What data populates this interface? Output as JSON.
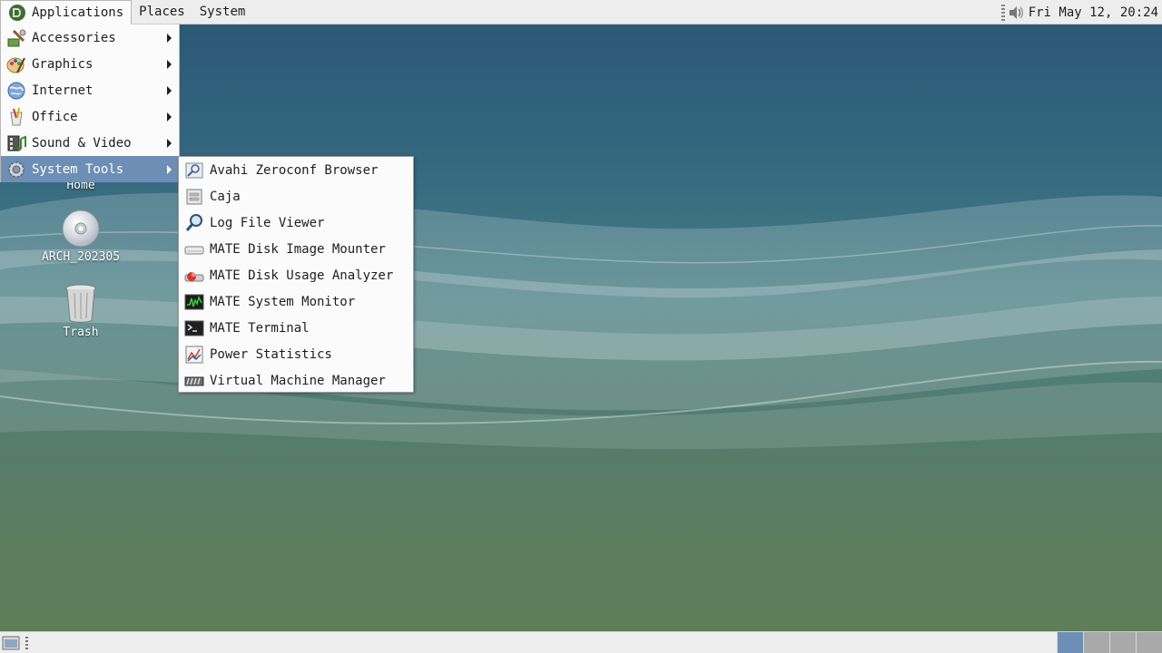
{
  "top_panel": {
    "menus": [
      {
        "label": "Applications",
        "active": true
      },
      {
        "label": "Places"
      },
      {
        "label": "System"
      }
    ],
    "clock": "Fri May 12, 20:24",
    "tray_icons": [
      "volume-icon"
    ]
  },
  "desktop": {
    "icons": [
      {
        "label": "Home",
        "icon": "home-folder-icon"
      },
      {
        "label": "ARCH_202305",
        "icon": "optical-disc-icon"
      },
      {
        "label": "Trash",
        "icon": "trash-icon"
      }
    ]
  },
  "app_menu": {
    "items": [
      {
        "label": "Accessories",
        "icon": "accessories-icon"
      },
      {
        "label": "Graphics",
        "icon": "graphics-icon"
      },
      {
        "label": "Internet",
        "icon": "internet-globe-icon"
      },
      {
        "label": "Office",
        "icon": "office-icon"
      },
      {
        "label": "Sound & Video",
        "icon": "sound-video-icon"
      },
      {
        "label": "System Tools",
        "icon": "system-tools-gear-icon",
        "highlighted": true
      }
    ]
  },
  "system_tools_submenu": {
    "items": [
      {
        "label": "Avahi Zeroconf Browser",
        "icon": "avahi-browser-icon"
      },
      {
        "label": "Caja",
        "icon": "caja-file-manager-icon"
      },
      {
        "label": "Log File Viewer",
        "icon": "log-viewer-icon"
      },
      {
        "label": "MATE Disk Image Mounter",
        "icon": "disk-image-mounter-icon"
      },
      {
        "label": "MATE Disk Usage Analyzer",
        "icon": "disk-usage-analyzer-icon"
      },
      {
        "label": "MATE System Monitor",
        "icon": "system-monitor-icon"
      },
      {
        "label": "MATE Terminal",
        "icon": "terminal-icon"
      },
      {
        "label": "Power Statistics",
        "icon": "power-statistics-icon"
      },
      {
        "label": "Virtual Machine Manager",
        "icon": "virt-manager-icon"
      }
    ]
  },
  "bottom_panel": {
    "workspaces": 4,
    "active_workspace": 1
  },
  "colors": {
    "highlight": "#6d8fb5",
    "panel": "#ededed",
    "menu_bg": "#fbfbfb"
  }
}
